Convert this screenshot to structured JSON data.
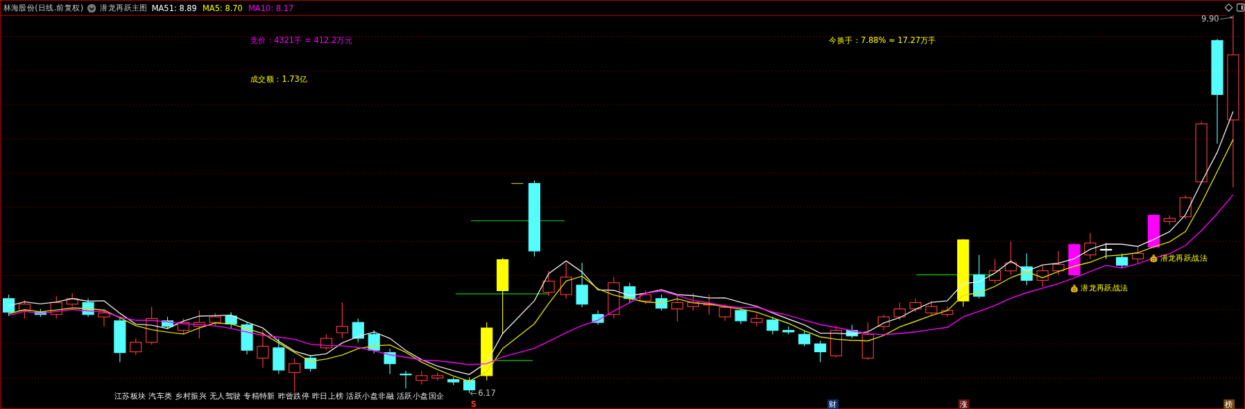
{
  "header": {
    "title": "林海股份(日线.前复权)",
    "indicator": "潜龙再跃主图",
    "averages": [
      {
        "label": "MA51: 8.89",
        "color": "#ffffff"
      },
      {
        "label": "MA5: 8.70",
        "color": "#ffff00"
      },
      {
        "label": "MA10: 8.17",
        "color": "#ff00ff"
      }
    ]
  },
  "annotations": {
    "auction": "竞价：4321手 = 412.2万元",
    "turnover": "今换手：7.88% ≈ 17.27万手",
    "amount": "成交额：1.73亿"
  },
  "chart": {
    "high_label": "9.90",
    "low_label": "6.17",
    "signals": [
      "潜龙再跃战法",
      "潜龙再跃战法"
    ],
    "concepts": "江苏板块 汽车类 乡村振兴 无人驾驶 专精特新 昨曾跌停 昨日上榜 活跃小盘非融 活跃小盘国企"
  },
  "markers": [
    {
      "label": "S",
      "kind": "sell"
    },
    {
      "label": "财",
      "kind": "finance"
    },
    {
      "label": "涨",
      "kind": "limit"
    },
    {
      "label": "榜",
      "kind": "list"
    }
  ]
}
